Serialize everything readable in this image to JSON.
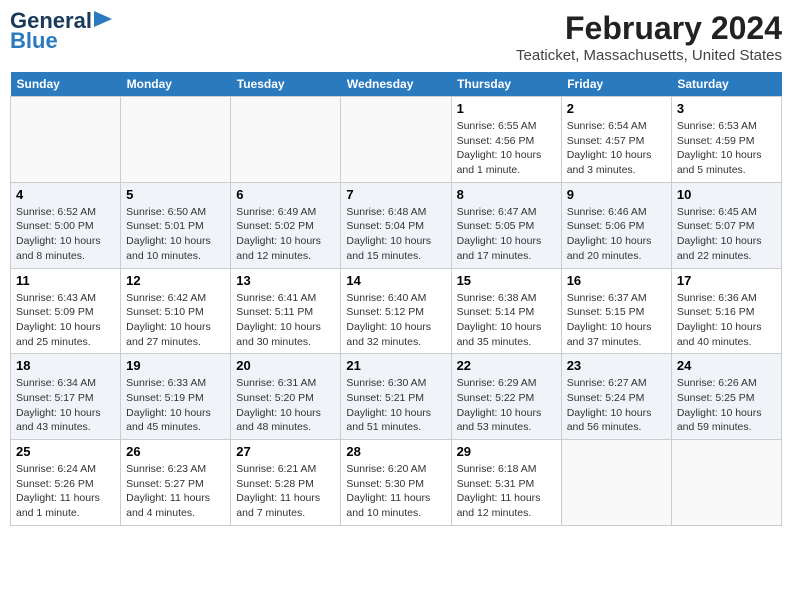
{
  "header": {
    "logo_line1": "General",
    "logo_line2": "Blue",
    "main_title": "February 2024",
    "subtitle": "Teaticket, Massachusetts, United States"
  },
  "days_of_week": [
    "Sunday",
    "Monday",
    "Tuesday",
    "Wednesday",
    "Thursday",
    "Friday",
    "Saturday"
  ],
  "weeks": [
    [
      {
        "day": "",
        "info": ""
      },
      {
        "day": "",
        "info": ""
      },
      {
        "day": "",
        "info": ""
      },
      {
        "day": "",
        "info": ""
      },
      {
        "day": "1",
        "info": "Sunrise: 6:55 AM\nSunset: 4:56 PM\nDaylight: 10 hours\nand 1 minute."
      },
      {
        "day": "2",
        "info": "Sunrise: 6:54 AM\nSunset: 4:57 PM\nDaylight: 10 hours\nand 3 minutes."
      },
      {
        "day": "3",
        "info": "Sunrise: 6:53 AM\nSunset: 4:59 PM\nDaylight: 10 hours\nand 5 minutes."
      }
    ],
    [
      {
        "day": "4",
        "info": "Sunrise: 6:52 AM\nSunset: 5:00 PM\nDaylight: 10 hours\nand 8 minutes."
      },
      {
        "day": "5",
        "info": "Sunrise: 6:50 AM\nSunset: 5:01 PM\nDaylight: 10 hours\nand 10 minutes."
      },
      {
        "day": "6",
        "info": "Sunrise: 6:49 AM\nSunset: 5:02 PM\nDaylight: 10 hours\nand 12 minutes."
      },
      {
        "day": "7",
        "info": "Sunrise: 6:48 AM\nSunset: 5:04 PM\nDaylight: 10 hours\nand 15 minutes."
      },
      {
        "day": "8",
        "info": "Sunrise: 6:47 AM\nSunset: 5:05 PM\nDaylight: 10 hours\nand 17 minutes."
      },
      {
        "day": "9",
        "info": "Sunrise: 6:46 AM\nSunset: 5:06 PM\nDaylight: 10 hours\nand 20 minutes."
      },
      {
        "day": "10",
        "info": "Sunrise: 6:45 AM\nSunset: 5:07 PM\nDaylight: 10 hours\nand 22 minutes."
      }
    ],
    [
      {
        "day": "11",
        "info": "Sunrise: 6:43 AM\nSunset: 5:09 PM\nDaylight: 10 hours\nand 25 minutes."
      },
      {
        "day": "12",
        "info": "Sunrise: 6:42 AM\nSunset: 5:10 PM\nDaylight: 10 hours\nand 27 minutes."
      },
      {
        "day": "13",
        "info": "Sunrise: 6:41 AM\nSunset: 5:11 PM\nDaylight: 10 hours\nand 30 minutes."
      },
      {
        "day": "14",
        "info": "Sunrise: 6:40 AM\nSunset: 5:12 PM\nDaylight: 10 hours\nand 32 minutes."
      },
      {
        "day": "15",
        "info": "Sunrise: 6:38 AM\nSunset: 5:14 PM\nDaylight: 10 hours\nand 35 minutes."
      },
      {
        "day": "16",
        "info": "Sunrise: 6:37 AM\nSunset: 5:15 PM\nDaylight: 10 hours\nand 37 minutes."
      },
      {
        "day": "17",
        "info": "Sunrise: 6:36 AM\nSunset: 5:16 PM\nDaylight: 10 hours\nand 40 minutes."
      }
    ],
    [
      {
        "day": "18",
        "info": "Sunrise: 6:34 AM\nSunset: 5:17 PM\nDaylight: 10 hours\nand 43 minutes."
      },
      {
        "day": "19",
        "info": "Sunrise: 6:33 AM\nSunset: 5:19 PM\nDaylight: 10 hours\nand 45 minutes."
      },
      {
        "day": "20",
        "info": "Sunrise: 6:31 AM\nSunset: 5:20 PM\nDaylight: 10 hours\nand 48 minutes."
      },
      {
        "day": "21",
        "info": "Sunrise: 6:30 AM\nSunset: 5:21 PM\nDaylight: 10 hours\nand 51 minutes."
      },
      {
        "day": "22",
        "info": "Sunrise: 6:29 AM\nSunset: 5:22 PM\nDaylight: 10 hours\nand 53 minutes."
      },
      {
        "day": "23",
        "info": "Sunrise: 6:27 AM\nSunset: 5:24 PM\nDaylight: 10 hours\nand 56 minutes."
      },
      {
        "day": "24",
        "info": "Sunrise: 6:26 AM\nSunset: 5:25 PM\nDaylight: 10 hours\nand 59 minutes."
      }
    ],
    [
      {
        "day": "25",
        "info": "Sunrise: 6:24 AM\nSunset: 5:26 PM\nDaylight: 11 hours\nand 1 minute."
      },
      {
        "day": "26",
        "info": "Sunrise: 6:23 AM\nSunset: 5:27 PM\nDaylight: 11 hours\nand 4 minutes."
      },
      {
        "day": "27",
        "info": "Sunrise: 6:21 AM\nSunset: 5:28 PM\nDaylight: 11 hours\nand 7 minutes."
      },
      {
        "day": "28",
        "info": "Sunrise: 6:20 AM\nSunset: 5:30 PM\nDaylight: 11 hours\nand 10 minutes."
      },
      {
        "day": "29",
        "info": "Sunrise: 6:18 AM\nSunset: 5:31 PM\nDaylight: 11 hours\nand 12 minutes."
      },
      {
        "day": "",
        "info": ""
      },
      {
        "day": "",
        "info": ""
      }
    ]
  ]
}
